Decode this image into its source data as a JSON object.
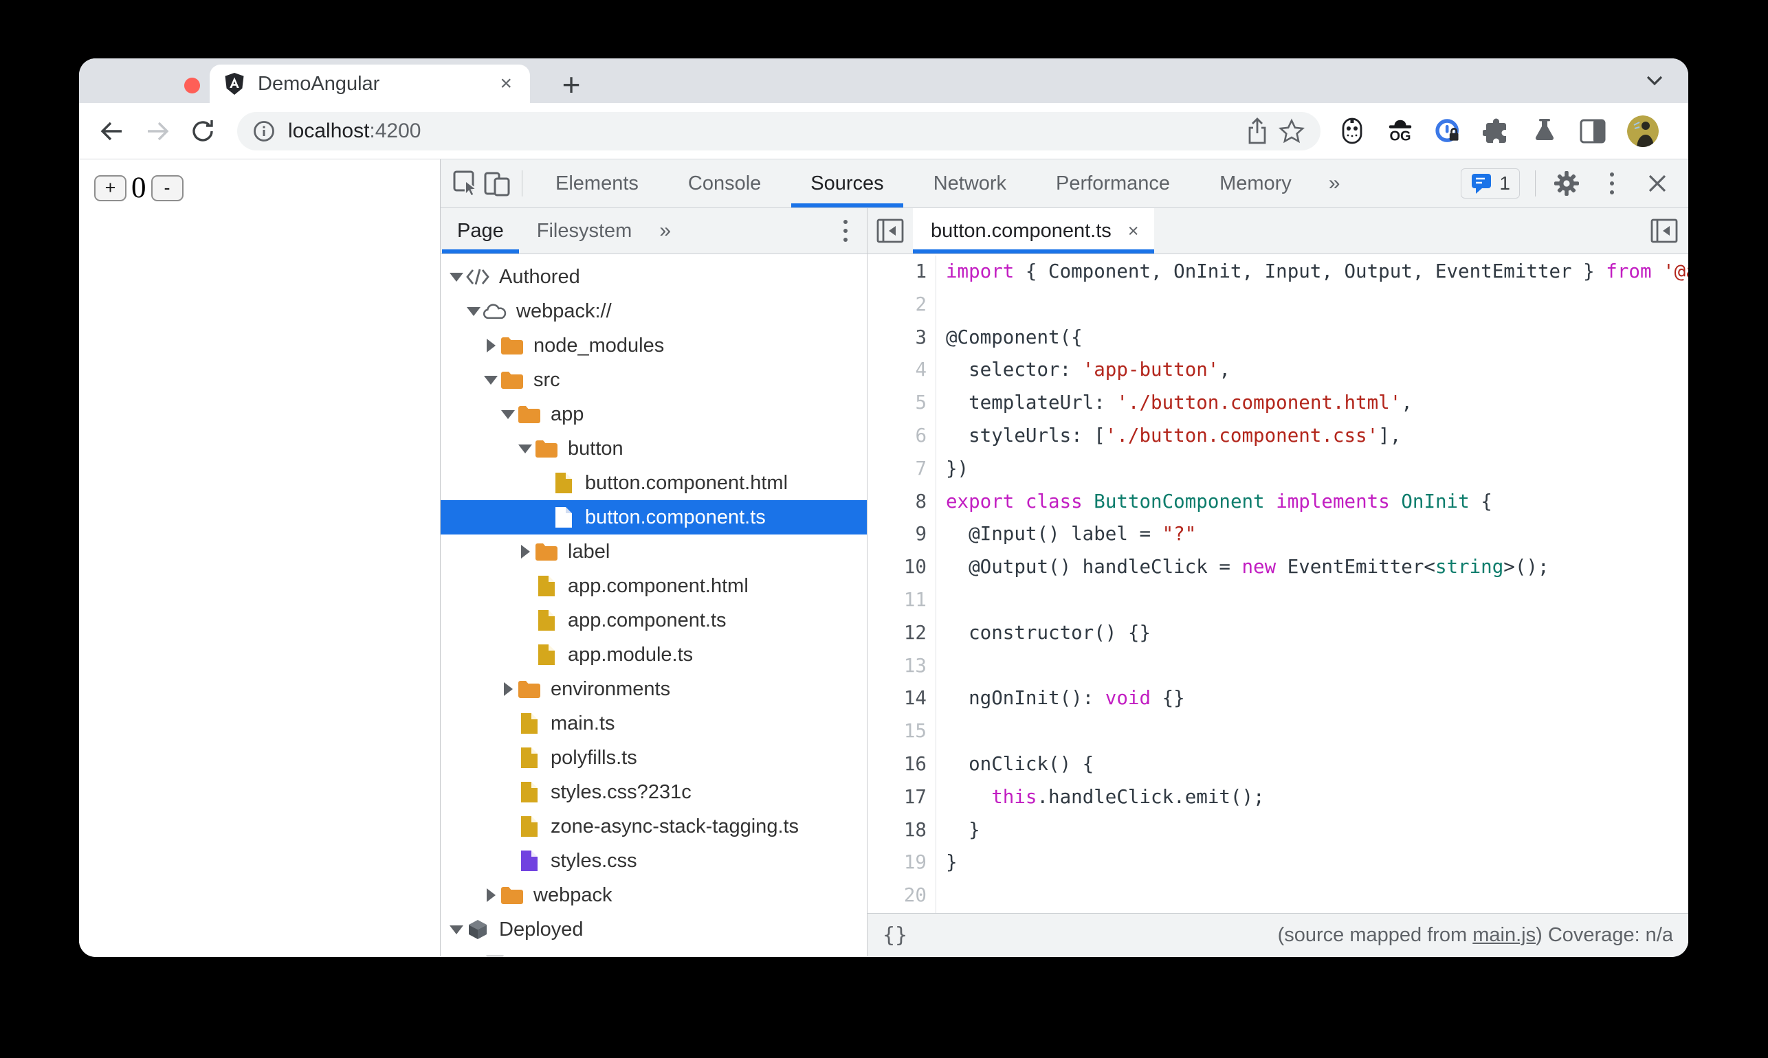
{
  "browser": {
    "traffic_lights": {
      "close_color": "#fe5f57",
      "minimize_color": "#febc2e",
      "zoom_color": "#28c840"
    },
    "tab": {
      "title": "DemoAngular",
      "close_label": "×",
      "new_tab_label": "+"
    },
    "url": {
      "host": "localhost",
      "port": ":4200"
    }
  },
  "page": {
    "increment_label": "+",
    "counter_value": "0",
    "decrement_label": "-"
  },
  "devtools": {
    "toolbar": {
      "tabs": [
        "Elements",
        "Console",
        "Sources",
        "Network",
        "Performance",
        "Memory"
      ],
      "active_tab": "Sources",
      "more_label": "»",
      "issues_count": "1"
    },
    "navigator": {
      "tabs": [
        "Page",
        "Filesystem"
      ],
      "active_tab": "Page",
      "more_label": "»",
      "tree": [
        {
          "label": "Authored",
          "icon": "code-icon",
          "level": 0,
          "arrow": "down"
        },
        {
          "label": "webpack://",
          "icon": "cloud-icon",
          "level": 1,
          "arrow": "down"
        },
        {
          "label": "node_modules",
          "icon": "folder-icon",
          "level": 2,
          "arrow": "right"
        },
        {
          "label": "src",
          "icon": "folder-icon",
          "level": 2,
          "arrow": "down"
        },
        {
          "label": "app",
          "icon": "folder-icon",
          "level": 3,
          "arrow": "down"
        },
        {
          "label": "button",
          "icon": "folder-icon",
          "level": 4,
          "arrow": "down"
        },
        {
          "label": "button.component.html",
          "icon": "file-icon",
          "level": 5,
          "arrow": "none"
        },
        {
          "label": "button.component.ts",
          "icon": "file-icon",
          "level": 5,
          "arrow": "none",
          "selected": true
        },
        {
          "label": "label",
          "icon": "folder-icon",
          "level": 4,
          "arrow": "right"
        },
        {
          "label": "app.component.html",
          "icon": "file-icon",
          "level": 4,
          "arrow": "none"
        },
        {
          "label": "app.component.ts",
          "icon": "file-icon",
          "level": 4,
          "arrow": "none"
        },
        {
          "label": "app.module.ts",
          "icon": "file-icon",
          "level": 4,
          "arrow": "none"
        },
        {
          "label": "environments",
          "icon": "folder-icon",
          "level": 3,
          "arrow": "right"
        },
        {
          "label": "main.ts",
          "icon": "file-icon",
          "level": 3,
          "arrow": "none"
        },
        {
          "label": "polyfills.ts",
          "icon": "file-icon",
          "level": 3,
          "arrow": "none"
        },
        {
          "label": "styles.css?231c",
          "icon": "file-icon",
          "level": 3,
          "arrow": "none"
        },
        {
          "label": "zone-async-stack-tagging.ts",
          "icon": "file-icon",
          "level": 3,
          "arrow": "none"
        },
        {
          "label": "styles.css",
          "icon": "file-purple-icon",
          "level": 3,
          "arrow": "none"
        },
        {
          "label": "webpack",
          "icon": "folder-icon",
          "level": 2,
          "arrow": "right"
        },
        {
          "label": "Deployed",
          "icon": "cube-icon",
          "level": 0,
          "arrow": "down"
        },
        {
          "label": "",
          "icon": "frame-icon",
          "level": 1,
          "arrow": "none"
        }
      ]
    },
    "editor": {
      "tab": {
        "title": "button.component.ts",
        "close_label": "×"
      },
      "code": {
        "lines": [
          {
            "n": "1",
            "dark": true,
            "t": [
              [
                "kw",
                "import"
              ],
              [
                "pl",
                " { Component, OnInit, Input, Output, EventEmitter } "
              ],
              [
                "kw",
                "from"
              ],
              [
                "pl",
                " "
              ],
              [
                "str",
                "'@a"
              ]
            ]
          },
          {
            "n": "2",
            "dark": false,
            "t": []
          },
          {
            "n": "3",
            "dark": true,
            "t": [
              [
                "pl",
                "@Component({"
              ]
            ]
          },
          {
            "n": "4",
            "dark": false,
            "t": [
              [
                "pl",
                "  selector: "
              ],
              [
                "str",
                "'app-button'"
              ],
              [
                "pl",
                ","
              ]
            ]
          },
          {
            "n": "5",
            "dark": false,
            "t": [
              [
                "pl",
                "  templateUrl: "
              ],
              [
                "str",
                "'./button.component.html'"
              ],
              [
                "pl",
                ","
              ]
            ]
          },
          {
            "n": "6",
            "dark": false,
            "t": [
              [
                "pl",
                "  styleUrls: ["
              ],
              [
                "str",
                "'./button.component.css'"
              ],
              [
                "pl",
                "],"
              ]
            ]
          },
          {
            "n": "7",
            "dark": false,
            "t": [
              [
                "pl",
                "})"
              ]
            ]
          },
          {
            "n": "8",
            "dark": true,
            "t": [
              [
                "kw",
                "export"
              ],
              [
                "pl",
                " "
              ],
              [
                "kw",
                "class"
              ],
              [
                "pl",
                " "
              ],
              [
                "ty",
                "ButtonComponent"
              ],
              [
                "pl",
                " "
              ],
              [
                "kw",
                "implements"
              ],
              [
                "pl",
                " "
              ],
              [
                "ty",
                "OnInit"
              ],
              [
                "pl",
                " {"
              ]
            ]
          },
          {
            "n": "9",
            "dark": true,
            "t": [
              [
                "pl",
                "  @Input() label = "
              ],
              [
                "str",
                "\"?\""
              ]
            ]
          },
          {
            "n": "10",
            "dark": true,
            "t": [
              [
                "pl",
                "  @Output() handleClick = "
              ],
              [
                "kw",
                "new"
              ],
              [
                "pl",
                " EventEmitter<"
              ],
              [
                "ty",
                "string"
              ],
              [
                "pl",
                ">();"
              ]
            ]
          },
          {
            "n": "11",
            "dark": false,
            "t": []
          },
          {
            "n": "12",
            "dark": true,
            "t": [
              [
                "pl",
                "  constructor() {}"
              ]
            ]
          },
          {
            "n": "13",
            "dark": false,
            "t": []
          },
          {
            "n": "14",
            "dark": true,
            "t": [
              [
                "pl",
                "  ngOnInit(): "
              ],
              [
                "kw",
                "void"
              ],
              [
                "pl",
                " {}"
              ]
            ]
          },
          {
            "n": "15",
            "dark": false,
            "t": []
          },
          {
            "n": "16",
            "dark": true,
            "t": [
              [
                "pl",
                "  onClick() {"
              ]
            ]
          },
          {
            "n": "17",
            "dark": true,
            "t": [
              [
                "pl",
                "    "
              ],
              [
                "kw",
                "this"
              ],
              [
                "pl",
                ".handleClick.emit();"
              ]
            ]
          },
          {
            "n": "18",
            "dark": true,
            "t": [
              [
                "pl",
                "  }"
              ]
            ]
          },
          {
            "n": "19",
            "dark": false,
            "t": [
              [
                "pl",
                "}"
              ]
            ]
          },
          {
            "n": "20",
            "dark": false,
            "t": []
          }
        ]
      },
      "status": {
        "format_label": "{}",
        "source_map_prefix": "(source mapped from ",
        "source_map_link": "main.js",
        "source_map_suffix": ") ",
        "coverage": "Coverage: n/a"
      }
    }
  },
  "colors": {
    "accent_blue": "#1a73e8",
    "selection_blue": "#1a73e8",
    "folder_orange": "#e8942f",
    "file_yellow": "#d5a71c",
    "file_purple": "#7142e0",
    "keyword": "#c21ec2",
    "string": "#b3261c",
    "type": "#0d7d6c",
    "code_default": "#303942"
  }
}
